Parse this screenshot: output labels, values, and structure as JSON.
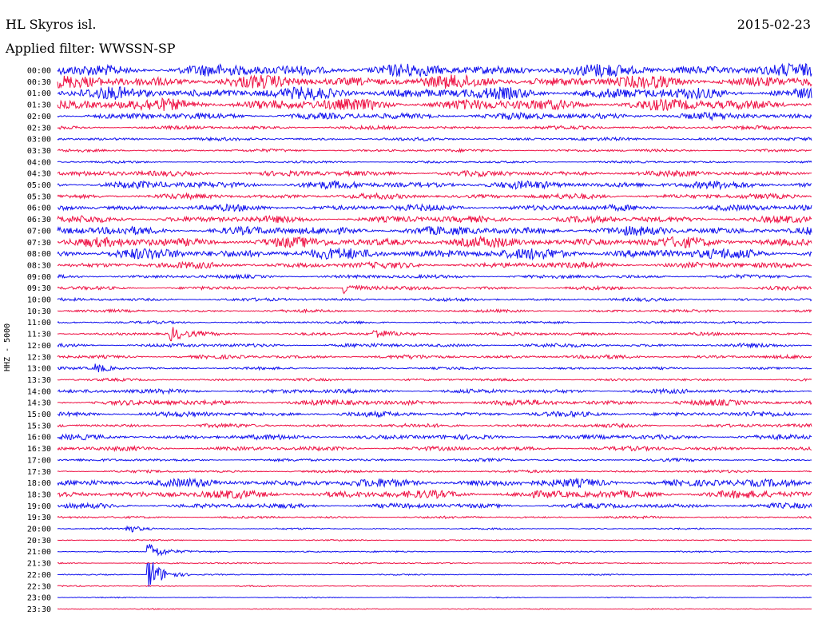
{
  "header": {
    "station": "HL Skyros isl.",
    "date": "2015-02-23",
    "filter": "Applied filter: WWSSN-SP",
    "channel": "HHZ - 5000"
  },
  "colors": {
    "odd": "#ee1144",
    "even": "#1111ee"
  },
  "chart_data": {
    "type": "line",
    "title": "",
    "ylabel": "HHZ - 5000",
    "categories": [
      "00:00",
      "00:30",
      "01:00",
      "01:30",
      "02:00",
      "02:30",
      "03:00",
      "03:30",
      "04:00",
      "04:30",
      "05:00",
      "05:30",
      "06:00",
      "06:30",
      "07:00",
      "07:30",
      "08:00",
      "08:30",
      "09:00",
      "09:30",
      "10:00",
      "10:30",
      "11:00",
      "11:30",
      "12:00",
      "12:30",
      "13:00",
      "13:30",
      "14:00",
      "14:30",
      "15:00",
      "15:30",
      "16:00",
      "16:30",
      "17:00",
      "17:30",
      "18:00",
      "18:30",
      "19:00",
      "19:30",
      "20:00",
      "20:30",
      "21:00",
      "21:30",
      "22:00",
      "22:30",
      "23:00",
      "23:30"
    ],
    "amplitude": [
      1.0,
      1.0,
      0.95,
      0.95,
      0.55,
      0.28,
      0.25,
      0.22,
      0.18,
      0.45,
      0.6,
      0.42,
      0.5,
      0.55,
      0.7,
      0.8,
      0.85,
      0.5,
      0.3,
      0.28,
      0.25,
      0.22,
      0.2,
      0.25,
      0.3,
      0.3,
      0.2,
      0.2,
      0.35,
      0.45,
      0.4,
      0.3,
      0.4,
      0.35,
      0.22,
      0.2,
      0.65,
      0.65,
      0.4,
      0.18,
      0.12,
      0.1,
      0.12,
      0.12,
      0.1,
      0.1,
      0.08,
      0.08
    ],
    "events": [
      {
        "trace": "09:30",
        "time": 0.38,
        "strength": 3
      },
      {
        "trace": "11:30",
        "time": 0.15,
        "strength": 3
      },
      {
        "trace": "11:30",
        "time": 0.42,
        "strength": 2
      },
      {
        "trace": "13:00",
        "time": 0.05,
        "strength": 2
      },
      {
        "trace": "20:00",
        "time": 0.09,
        "strength": 2
      },
      {
        "trace": "21:00",
        "time": 0.12,
        "strength": 4
      },
      {
        "trace": "22:00",
        "time": 0.12,
        "strength": 8
      }
    ]
  }
}
